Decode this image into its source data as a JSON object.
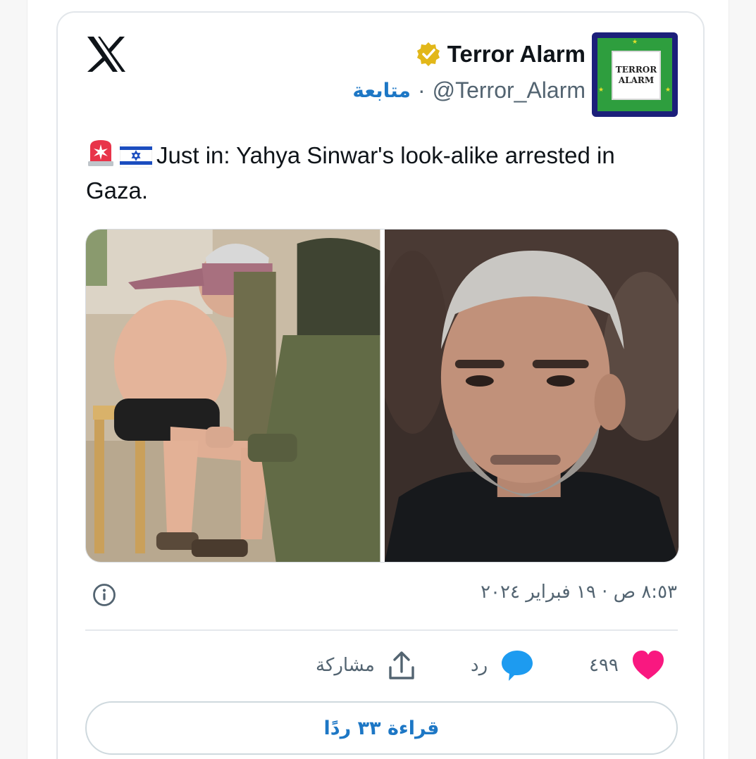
{
  "tweet": {
    "author": {
      "name": "Terror Alarm",
      "handle": "@Terror_Alarm",
      "separator": "·",
      "follow_label": "متابعة",
      "avatar_text_line1": "TERROR",
      "avatar_text_line2": "ALARM"
    },
    "text": {
      "emojis": [
        "rotating-light-icon",
        "israel-flag-icon"
      ],
      "body": "Just in: Yahya Sinwar's look-alike arrested in Gaza."
    },
    "media": [
      {
        "name": "photo-arrest"
      },
      {
        "name": "photo-portrait"
      }
    ],
    "timestamp": "٨:٥٣ ص · ١٩ فبراير ٢٠٢٤",
    "actions": {
      "like_count": "٤٩٩",
      "reply_label": "رد",
      "share_label": "مشاركة"
    },
    "read_replies_label": "قراءة ٣٣ ردًا"
  },
  "colors": {
    "accent": "#1d77c5",
    "like": "#f91880",
    "reply": "#1d9bf0",
    "verified": "#e2b719",
    "avatar_border": "#1c1f7a",
    "avatar_fill": "#2e9e3e"
  },
  "icons": {
    "logo": "x-logo-icon",
    "verified": "verified-badge-icon",
    "info": "info-icon",
    "like": "heart-icon",
    "reply": "speech-bubble-icon",
    "share": "share-upload-icon"
  }
}
